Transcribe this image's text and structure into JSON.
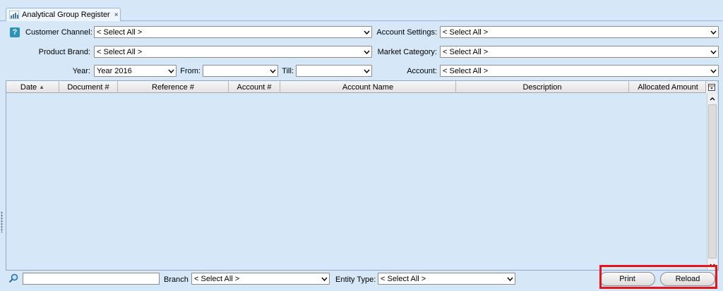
{
  "tab": {
    "title": "Analytical Group Register",
    "close": "×"
  },
  "filters": {
    "customer_channel": {
      "label": "Customer Channel:",
      "value": "< Select All >"
    },
    "account_settings": {
      "label": "Account Settings:",
      "value": "< Select All >"
    },
    "product_brand": {
      "label": "Product Brand:",
      "value": "< Select All >"
    },
    "market_category": {
      "label": "Market Category:",
      "value": "< Select All >"
    },
    "year": {
      "label": "Year:",
      "value": "Year 2016"
    },
    "from": {
      "label": "From:",
      "value": ""
    },
    "till": {
      "label": "Till:",
      "value": ""
    },
    "account": {
      "label": "Account:",
      "value": "< Select All >"
    }
  },
  "grid": {
    "columns": [
      "Date",
      "Document #",
      "Reference #",
      "Account #",
      "Account Name",
      "Description",
      "Allocated Amount"
    ],
    "sort_indicator": "▲",
    "rows": []
  },
  "footer": {
    "search_value": "",
    "branch": {
      "label": "Branch",
      "value": "< Select All >"
    },
    "entity_type": {
      "label": "Entity Type:",
      "value": "< Select All >"
    },
    "print_label": "Print",
    "reload_label": "Reload"
  },
  "colors": {
    "background": "#d6e7f7",
    "highlight": "#e5151b",
    "help_icon": "#2b93b9"
  },
  "icons": {
    "tab": "chart-icon",
    "help": "help-icon",
    "search": "search-icon"
  }
}
